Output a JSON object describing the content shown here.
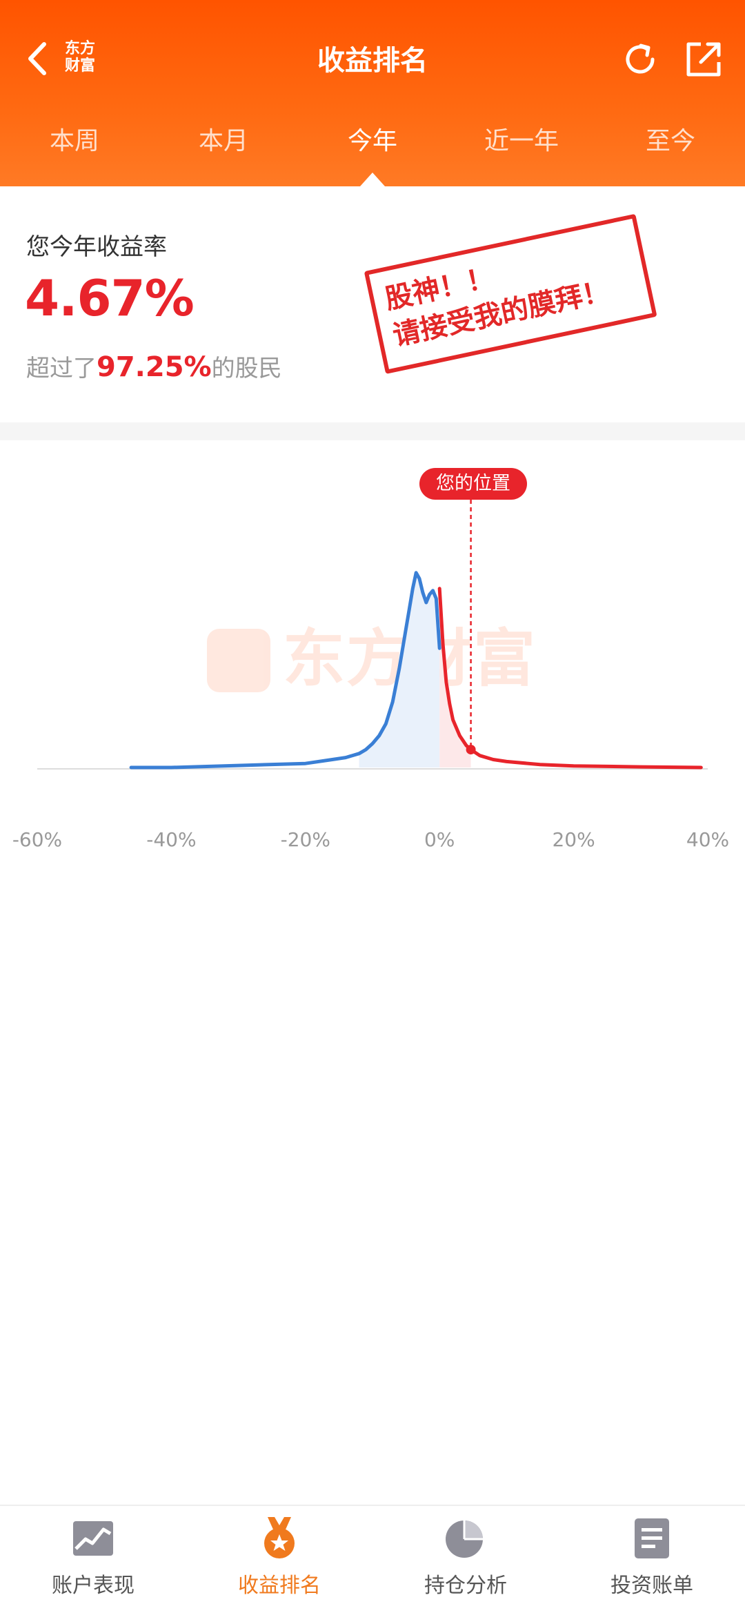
{
  "header": {
    "logo_line1": "东方",
    "logo_line2": "财富",
    "title": "收益排名"
  },
  "tabs": [
    {
      "label": "本周",
      "active": false
    },
    {
      "label": "本月",
      "active": false
    },
    {
      "label": "今年",
      "active": true
    },
    {
      "label": "近一年",
      "active": false
    },
    {
      "label": "至今",
      "active": false
    }
  ],
  "summary": {
    "label": "您今年收益率",
    "value": "4.67%",
    "rank_prefix": "超过了",
    "rank_percent": "97.25%",
    "rank_suffix": "的股民",
    "stamp_line1": "股神！！",
    "stamp_line2": "请接受我的膜拜！"
  },
  "chart": {
    "marker_label": "您的位置",
    "watermark": "东方财富",
    "colors": {
      "negative": "#3a7fd5",
      "positive": "#e8242b",
      "negative_fill": "#e9f1fb",
      "positive_fill": "#fde8e9"
    }
  },
  "chart_data": {
    "type": "area",
    "x_tick_labels": [
      "-60%",
      "-40%",
      "-20%",
      "0%",
      "20%",
      "40%"
    ],
    "xlim": [
      -60,
      40
    ],
    "ylim": [
      0,
      1
    ],
    "marker_x": 4.67,
    "series": [
      {
        "x": [
          -46,
          -40,
          -30,
          -20,
          -16,
          -14,
          -12,
          -11,
          -10,
          -9,
          -8,
          -7,
          -6,
          -5,
          -4.5,
          -4,
          -3.5,
          -3,
          -2.5,
          -2,
          -1.5,
          -1,
          -0.5,
          0
        ],
        "values": [
          0.0,
          0.0,
          0.01,
          0.02,
          0.04,
          0.05,
          0.07,
          0.09,
          0.12,
          0.16,
          0.22,
          0.33,
          0.5,
          0.7,
          0.8,
          0.9,
          0.98,
          0.95,
          0.88,
          0.83,
          0.87,
          0.89,
          0.85,
          0.6
        ]
      },
      {
        "x": [
          0,
          0.5,
          1,
          1.5,
          2,
          3,
          4,
          4.67,
          6,
          8,
          10,
          15,
          20,
          30,
          39
        ],
        "values": [
          0.9,
          0.62,
          0.43,
          0.32,
          0.24,
          0.16,
          0.11,
          0.09,
          0.06,
          0.04,
          0.03,
          0.015,
          0.008,
          0.003,
          0.0
        ]
      }
    ]
  },
  "bottom_nav": [
    {
      "label": "账户表现",
      "icon": "chart-trend-icon",
      "active": false
    },
    {
      "label": "收益排名",
      "icon": "medal-icon",
      "active": true
    },
    {
      "label": "持仓分析",
      "icon": "pie-icon",
      "active": false
    },
    {
      "label": "投资账单",
      "icon": "bill-icon",
      "active": false
    }
  ]
}
